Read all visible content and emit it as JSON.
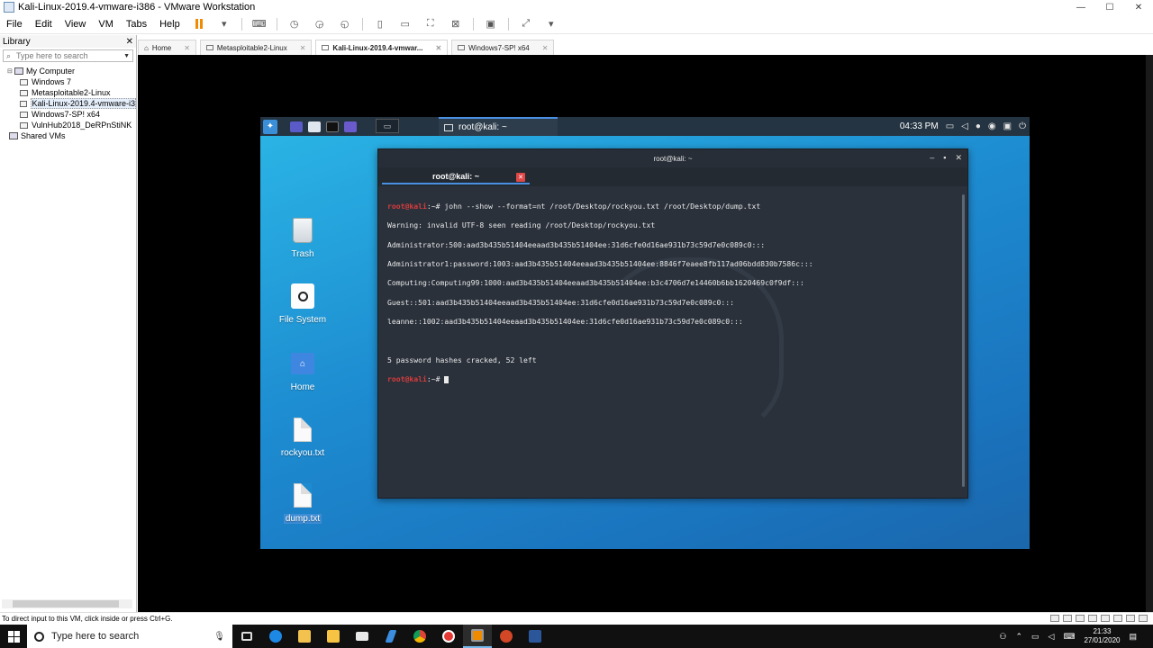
{
  "window": {
    "title": "Kali-Linux-2019.4-vmware-i386 - VMware Workstation",
    "min": "—",
    "max": "☐",
    "close": "✕"
  },
  "menu": [
    "File",
    "Edit",
    "View",
    "VM",
    "Tabs",
    "Help"
  ],
  "library": {
    "title": "Library",
    "close": "✕",
    "search_placeholder": "Type here to search",
    "root": "My Computer",
    "vms": [
      "Windows 7",
      "Metasploitable2-Linux",
      "Kali-Linux-2019.4-vmware-i3",
      "Windows7-SP! x64",
      "VulnHub2018_DeRPnStiNK"
    ],
    "shared": "Shared VMs"
  },
  "tabs": [
    {
      "label": "Home",
      "active": false
    },
    {
      "label": "Metasploitable2-Linux",
      "active": false
    },
    {
      "label": "Kali-Linux-2019.4-vmwar...",
      "active": true
    },
    {
      "label": "Windows7-SP! x64",
      "active": false
    }
  ],
  "kali_panel": {
    "task_label": "root@kali: ~",
    "time": "04:33 PM"
  },
  "desktop_icons": [
    {
      "label": "Trash"
    },
    {
      "label": "File System"
    },
    {
      "label": "Home"
    },
    {
      "label": "rockyou.txt"
    },
    {
      "label": "dump.txt"
    }
  ],
  "terminal": {
    "window_title": "root@kali: ~",
    "tab_label": "root@kali: ~",
    "prompt": "root@kali",
    "prompt_suffix": ":~# ",
    "command": "john --show --format=nt /root/Desktop/rockyou.txt /root/Desktop/dump.txt",
    "output": [
      "Warning: invalid UTF-8 seen reading /root/Desktop/rockyou.txt",
      "Administrator:500:aad3b435b51404eeaad3b435b51404ee:31d6cfe0d16ae931b73c59d7e0c089c0:::",
      "Administrator1:password:1003:aad3b435b51404eeaad3b435b51404ee:8846f7eaee8fb117ad06bdd830b7586c:::",
      "Computing:Computing99:1000:aad3b435b51404eeaad3b435b51404ee:b3c4706d7e14460b6bb1620469c0f9df:::",
      "Guest::501:aad3b435b51404eeaad3b435b51404ee:31d6cfe0d16ae931b73c59d7e0c089c0:::",
      "leanne::1002:aad3b435b51404eeaad3b435b51404ee:31d6cfe0d16ae931b73c59d7e0c089c0:::",
      "",
      "5 password hashes cracked, 52 left"
    ]
  },
  "statusbar": {
    "text": "To direct input to this VM, click inside or press Ctrl+G."
  },
  "taskbar": {
    "search_placeholder": "Type here to search",
    "time": "21:33",
    "date": "27/01/2020"
  }
}
